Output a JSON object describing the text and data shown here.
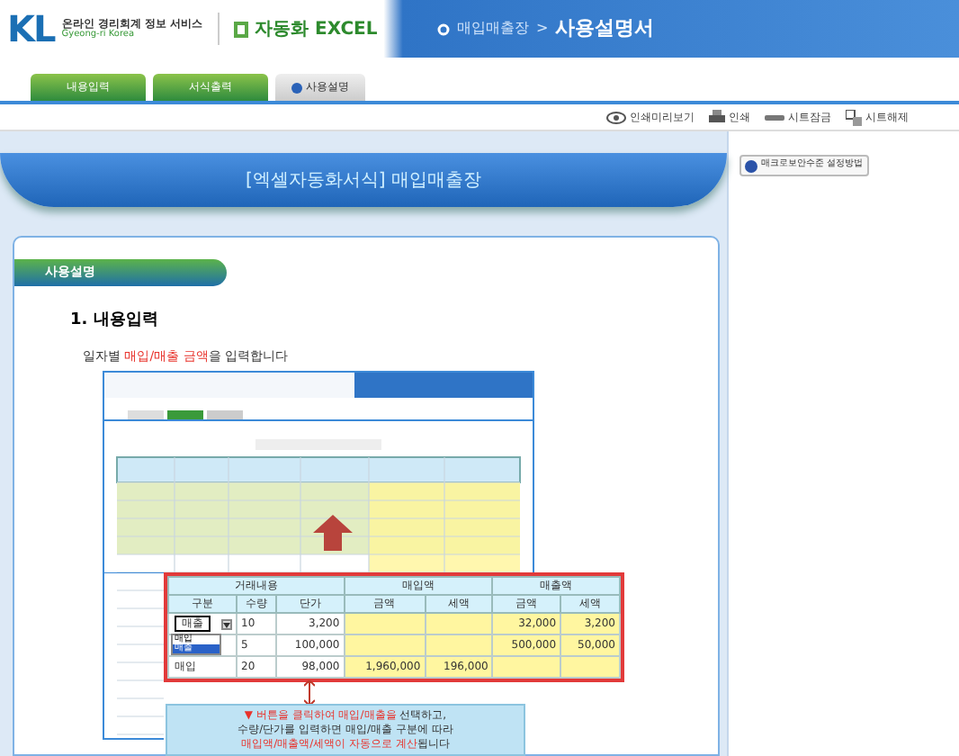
{
  "header": {
    "logo": "KL",
    "service_name": "온라인 경리회계 정보 서비스",
    "service_sub": "Gyeong-ri Korea",
    "product": "자동화 EXCEL",
    "breadcrumb": [
      "매입매출장",
      ">",
      "사용설명서"
    ]
  },
  "tabs": [
    {
      "label": "내용입력",
      "selected": false
    },
    {
      "label": "서식출력",
      "selected": false
    },
    {
      "label": "사용설명",
      "selected": true
    }
  ],
  "toolbar": [
    {
      "label": "인쇄미리보기",
      "kind": "preview"
    },
    {
      "label": "인쇄",
      "kind": "print"
    },
    {
      "label": "시트잠금",
      "kind": "lock"
    },
    {
      "label": "시트해제",
      "kind": "unlock"
    }
  ],
  "banner_title": "[엑셀자동화서식] 매입매출장",
  "side_button": "매크로보안수준 설정방법",
  "section_label": "사용설명",
  "step_title": "1. 내용입력",
  "step_text": [
    {
      "text": "일자별 ",
      "highlight": false
    },
    {
      "text": "매입/매출 금액",
      "highlight": true
    },
    {
      "text": "을 입력합니다",
      "highlight": false
    }
  ],
  "callout_table": {
    "groups": [
      {
        "label": "거래내용"
      },
      {
        "label": "매입액"
      },
      {
        "label": "매출액"
      }
    ],
    "columns": [
      "구분",
      "수량",
      "단가",
      "금액",
      "세액",
      "금액",
      "세액"
    ],
    "rows": [
      {
        "cells": [
          "매출",
          "10",
          "3,200",
          "",
          "",
          "32,000",
          "3,200"
        ],
        "dropdown": true
      },
      {
        "cells": [
          "",
          "5",
          "100,000",
          "",
          "",
          "500,000",
          "50,000"
        ],
        "dropdown": false
      },
      {
        "cells": [
          "매입",
          "20",
          "98,000",
          "1,960,000",
          "196,000",
          "",
          ""
        ],
        "dropdown": false
      }
    ],
    "open_options": [
      {
        "label": "매입",
        "selected": false
      },
      {
        "label": "매출",
        "selected": true
      }
    ]
  },
  "tip_lines": [
    [
      {
        "text": "▼ 버튼을 클릭하여 매입/매출을",
        "highlight": true
      },
      {
        "text": " 선택하고,",
        "highlight": false
      }
    ],
    [
      {
        "text": "수량/단가를 입력하면 매입/매출 구분에 따라",
        "highlight": false
      }
    ],
    [
      {
        "text": "매입액/매출액/세액이 자동으로 계산",
        "highlight": true
      },
      {
        "text": "됩니다",
        "highlight": false
      }
    ]
  ]
}
